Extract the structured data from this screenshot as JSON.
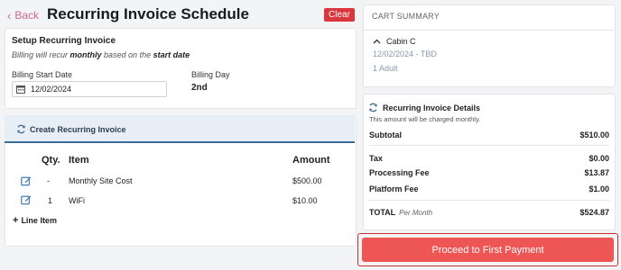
{
  "header": {
    "back_label": "Back",
    "title": "Recurring Invoice Schedule",
    "clear_label": "Clear"
  },
  "setup": {
    "title": "Setup Recurring Invoice",
    "subtitle_pre": "Billing will recur ",
    "subtitle_bold1": "monthly",
    "subtitle_mid": " based on the ",
    "subtitle_bold2": "start date",
    "start_date_label": "Billing Start Date",
    "start_date_value": "12/02/2024",
    "billing_day_label": "Billing Day",
    "billing_day_value": "2nd"
  },
  "invoice": {
    "header_label": "Create Recurring Invoice",
    "columns": {
      "qty": "Qty.",
      "item": "Item",
      "amount": "Amount"
    },
    "rows": [
      {
        "qty": "-",
        "item": "Monthly Site Cost",
        "amount": "$500.00"
      },
      {
        "qty": "1",
        "item": "WiFi",
        "amount": "$10.00"
      }
    ],
    "add_line_label": "Line Item",
    "add_line_symbol": "+"
  },
  "cart": {
    "title": "CART SUMMARY",
    "site_name": "Cabin C",
    "dates": "12/02/2024 - TBD",
    "guests": "1 Adult"
  },
  "details": {
    "title": "Recurring Invoice Details",
    "subtitle": "This amount will be charged monthly.",
    "subtotal_label": "Subtotal",
    "subtotal_value": "$510.00",
    "tax_label": "Tax",
    "tax_value": "$0.00",
    "processing_label": "Processing Fee",
    "processing_value": "$13.87",
    "platform_label": "Platform Fee",
    "platform_value": "$1.00",
    "total_label": "TOTAL",
    "total_per": "Per Month",
    "total_value": "$524.87"
  },
  "proceed_label": "Proceed to First Payment",
  "colors": {
    "accent_blue": "#3d6a99",
    "danger": "#d9363e",
    "proceed": "#ee5555"
  }
}
